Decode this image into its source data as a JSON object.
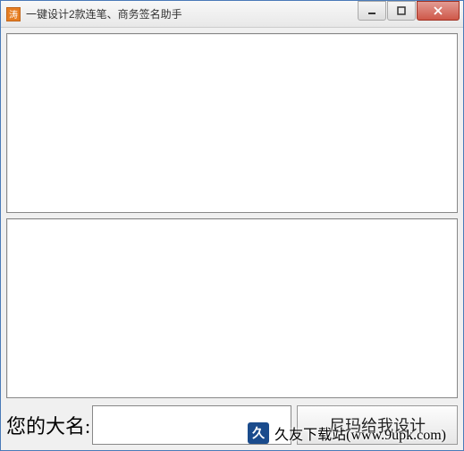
{
  "window": {
    "title": "一键设计2款连笔、商务签名助手",
    "icon_label": "涛"
  },
  "bottom": {
    "name_label": "您的大名:",
    "name_value": "",
    "design_button": "尼玛给我设计"
  },
  "watermark": {
    "logo_text": "久",
    "text": "久友下载站(www.9upk.com)"
  }
}
